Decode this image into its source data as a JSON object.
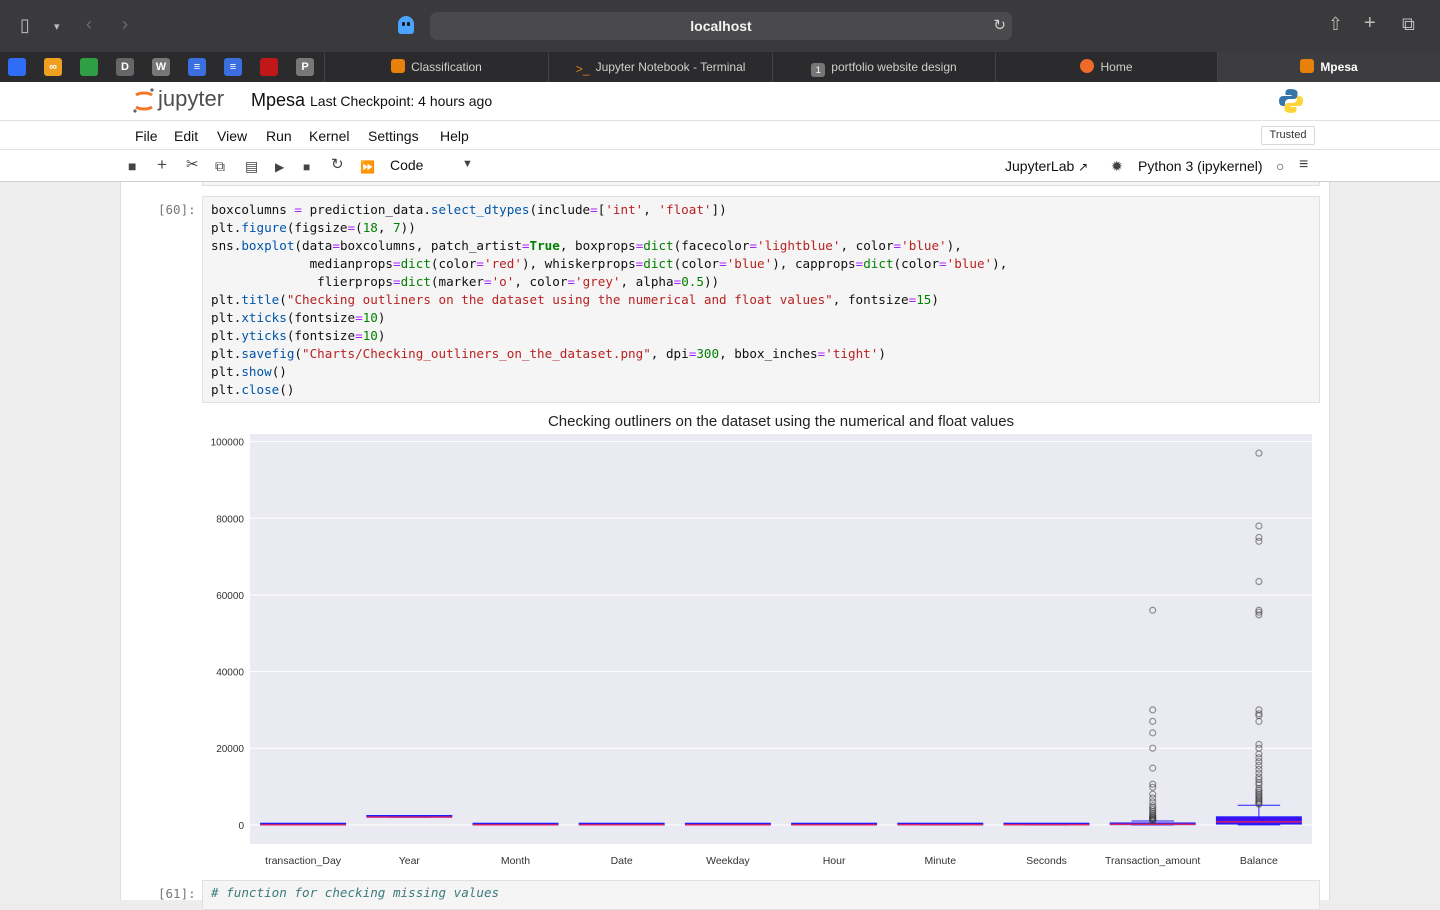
{
  "browser": {
    "url": "localhost",
    "tabs": [
      {
        "label": "Classification",
        "icon": "notebook-icon"
      },
      {
        "label": "Jupyter Notebook - Terminal",
        "icon": "terminal-icon"
      },
      {
        "label": "portfolio website design",
        "icon": "numbered-tab-icon",
        "badge": "1"
      },
      {
        "label": "Home",
        "icon": "home-icon"
      },
      {
        "label": "Mpesa",
        "icon": "notebook-icon"
      }
    ],
    "pinned": [
      {
        "glyph": "",
        "color": "#2f6df6"
      },
      {
        "glyph": "∞",
        "color": "#f0a020"
      },
      {
        "glyph": "",
        "color": "#2f9e44"
      },
      {
        "glyph": "D",
        "color": "#666666"
      },
      {
        "glyph": "W",
        "color": "#777777"
      },
      {
        "glyph": "≡",
        "color": "#3b6fe0"
      },
      {
        "glyph": "≡",
        "color": "#3b6fe0"
      },
      {
        "glyph": "",
        "color": "#c01818"
      },
      {
        "glyph": "P",
        "color": "#777777"
      }
    ]
  },
  "jupyter": {
    "logo_text": "jupyter",
    "notebook_name": "Mpesa",
    "checkpoint": "Last Checkpoint: 4 hours ago",
    "menu": [
      "File",
      "Edit",
      "View",
      "Run",
      "Kernel",
      "Settings",
      "Help"
    ],
    "trusted": "Trusted",
    "cell_type": "Code",
    "jupyterlab_link": "JupyterLab",
    "kernel": "Python 3 (ipykernel)"
  },
  "cells": {
    "current_prompt": "[60]:",
    "next_prompt": "[61]:",
    "next_code": "# function for checking missing values"
  },
  "chart_data": {
    "type": "box",
    "title": "Checking outliners on the dataset using the numerical and float values",
    "categories": [
      "transaction_Day",
      "Year",
      "Month",
      "Date",
      "Weekday",
      "Hour",
      "Minute",
      "Seconds",
      "Transaction_amount",
      "Balance"
    ],
    "ylim": [
      -5000,
      102000
    ],
    "yticks": [
      0,
      20000,
      40000,
      60000,
      80000,
      100000
    ],
    "boxes": [
      {
        "q1": 8,
        "median": 16,
        "q3": 24,
        "whisker_low": 1,
        "whisker_high": 31,
        "outliers": []
      },
      {
        "q1": 2022,
        "median": 2022,
        "q3": 2023,
        "whisker_low": 2022,
        "whisker_high": 2023,
        "outliers": []
      },
      {
        "q1": 3,
        "median": 6,
        "q3": 9,
        "whisker_low": 1,
        "whisker_high": 12,
        "outliers": []
      },
      {
        "q1": 8,
        "median": 16,
        "q3": 24,
        "whisker_low": 1,
        "whisker_high": 31,
        "outliers": []
      },
      {
        "q1": 1,
        "median": 3,
        "q3": 5,
        "whisker_low": 0,
        "whisker_high": 6,
        "outliers": []
      },
      {
        "q1": 8,
        "median": 13,
        "q3": 18,
        "whisker_low": 0,
        "whisker_high": 23,
        "outliers": []
      },
      {
        "q1": 15,
        "median": 30,
        "q3": 45,
        "whisker_low": 0,
        "whisker_high": 59,
        "outliers": []
      },
      {
        "q1": 15,
        "median": 30,
        "q3": 45,
        "whisker_low": 0,
        "whisker_high": 59,
        "outliers": []
      },
      {
        "q1": 50,
        "median": 150,
        "q3": 500,
        "whisker_low": 1,
        "whisker_high": 1000,
        "outliers": [
          56000,
          30000,
          27000,
          24000,
          20000,
          14800,
          10600,
          9800,
          8000,
          7000,
          6000,
          5000,
          4500,
          4000,
          3500,
          3000,
          2600,
          2300,
          2000,
          1800,
          1600,
          1400,
          1200,
          1100
        ]
      },
      {
        "q1": 200,
        "median": 800,
        "q3": 2100,
        "whisker_low": 1,
        "whisker_high": 5100,
        "outliers": [
          97000,
          78000,
          75000,
          74000,
          63500,
          56000,
          55500,
          54800,
          30000,
          29000,
          28500,
          27000,
          21000,
          20000,
          18500,
          17500,
          16500,
          15500,
          14500,
          13500,
          12500,
          11800,
          11000,
          10500,
          9500,
          9000,
          8500,
          8000,
          7600,
          7200,
          6800,
          6400,
          6000,
          5700,
          5400
        ]
      }
    ]
  }
}
